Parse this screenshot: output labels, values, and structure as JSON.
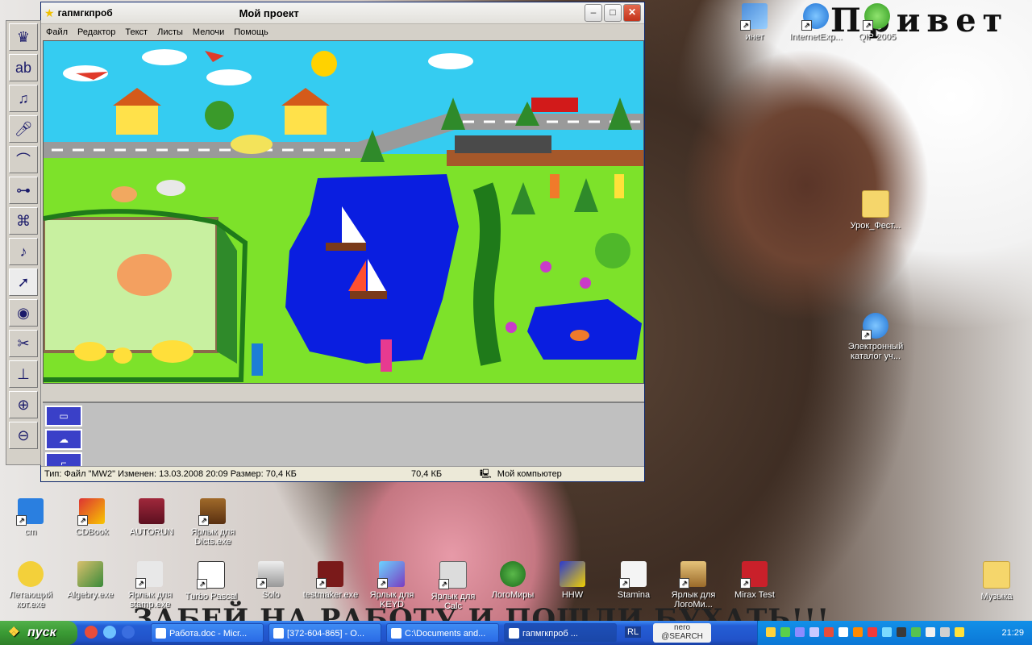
{
  "wallpaper": {
    "header_text": "Привет",
    "slogan": "ЗАБЕЙ НА РАБОТУ И ПОШЛИ БУХАТЬ!!!"
  },
  "window": {
    "title_left": "гапмгкпроб",
    "title_center": "Мой проект",
    "menu": [
      "Файл",
      "Редактор",
      "Текст",
      "Листы",
      "Мелочи",
      "Помощь"
    ],
    "status": {
      "info": "Тип: Файл \"MW2\" Изменен: 13.03.2008 20:09 Размер: 70,4 КБ",
      "size": "70,4 КБ",
      "location": "Мой компьютер"
    }
  },
  "tools": [
    "crown-icon",
    "alphabet-icon",
    "music-note-icon",
    "microphone-icon",
    "satellite-dish-icon",
    "slider-icon",
    "film-camera-icon",
    "cd-music-icon",
    "pointer-icon",
    "eye-icon",
    "scissors-icon",
    "stamp-icon",
    "zoom-in-icon",
    "zoom-out-icon"
  ],
  "desktop_icons_top": [
    {
      "label": "инет"
    },
    {
      "label": "InternetExp..."
    },
    {
      "label": "QIP 2005"
    }
  ],
  "desktop_icons_right": [
    {
      "label": "Урок_Фест..."
    },
    {
      "label": "Электронный каталог уч..."
    },
    {
      "label": "Музыка"
    }
  ],
  "desktop_icons_row1": [
    {
      "label": "cm"
    },
    {
      "label": "CDBook"
    },
    {
      "label": "AUTORUN"
    },
    {
      "label": "Ярлык для Dicts.exe"
    }
  ],
  "desktop_icons_row2": [
    {
      "label": "Летающий кот.exe"
    },
    {
      "label": "Algebry.exe"
    },
    {
      "label": "Ярлык для stamp.exe"
    },
    {
      "label": "Turbo Pascal"
    },
    {
      "label": "Solo"
    },
    {
      "label": "testmaker.exe"
    },
    {
      "label": "Ярлык для KEYD"
    },
    {
      "label": "Ярлык для Calc"
    },
    {
      "label": "ЛогоМиры"
    },
    {
      "label": "HHW"
    },
    {
      "label": "Stamina"
    },
    {
      "label": "Ярлык для ЛогоМи..."
    },
    {
      "label": "Mirax Test"
    }
  ],
  "taskbar": {
    "start": "пуск",
    "buttons": [
      "Работа.doc - Micr...",
      "[372-604-865] - О...",
      "C:\\Documents and...",
      "гапмгкпроб ..."
    ],
    "lang": "RL",
    "nero": "nero @SEARCH",
    "clock": "21:29"
  }
}
